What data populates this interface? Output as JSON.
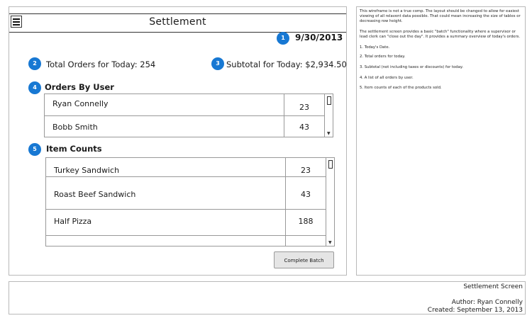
{
  "header": {
    "title": "Settlement",
    "menu_icon": "hamburger-menu-icon"
  },
  "summary": {
    "date": "9/30/2013",
    "total_orders": "Total Orders for Today: 254",
    "subtotal": "Subtotal for Today: $2,934.50"
  },
  "badges": [
    "1",
    "2",
    "3",
    "4",
    "5"
  ],
  "orders_by_user": {
    "heading": "Orders By User",
    "rows": [
      {
        "name": "Ryan Connelly",
        "value": "23"
      },
      {
        "name": "Bobb Smith",
        "value": "43"
      }
    ]
  },
  "item_counts": {
    "heading": "Item Counts",
    "rows": [
      {
        "name": "Turkey Sandwich",
        "value": "23"
      },
      {
        "name": "Roast Beef Sandwich",
        "value": "43"
      },
      {
        "name": "Half Pizza",
        "value": "188"
      },
      {
        "name": "",
        "value": ""
      }
    ]
  },
  "actions": {
    "complete_batch": "Complete Batch"
  },
  "notes": {
    "p1": "This wireframe is not a true comp. The layout should be changed to allow for easiest viewing of all relavent data possible. That could mean increasing the size of tables or decreasing row height.",
    "p2": "The settlement screen provides a basic \"batch\" functionality where a supervisor or lead clerk can \"close out the day\". It provides a summary overview of today's orders.",
    "i1": "1. Today's Date.",
    "i2": "2. Total orders for today.",
    "i3": "3.  Subtotal (not including taxes or discounts) for today.",
    "i4": "4. A list of all orders by user.",
    "i5": "5. Item counts of each of the products sold."
  },
  "footer": {
    "screen": "Settlement Screen",
    "author": "Author: Ryan Connelly",
    "created": "Created: September 13, 2013"
  },
  "colors": {
    "badge": "#1778d3",
    "button": "#e5e5e5",
    "border": "#999999"
  }
}
